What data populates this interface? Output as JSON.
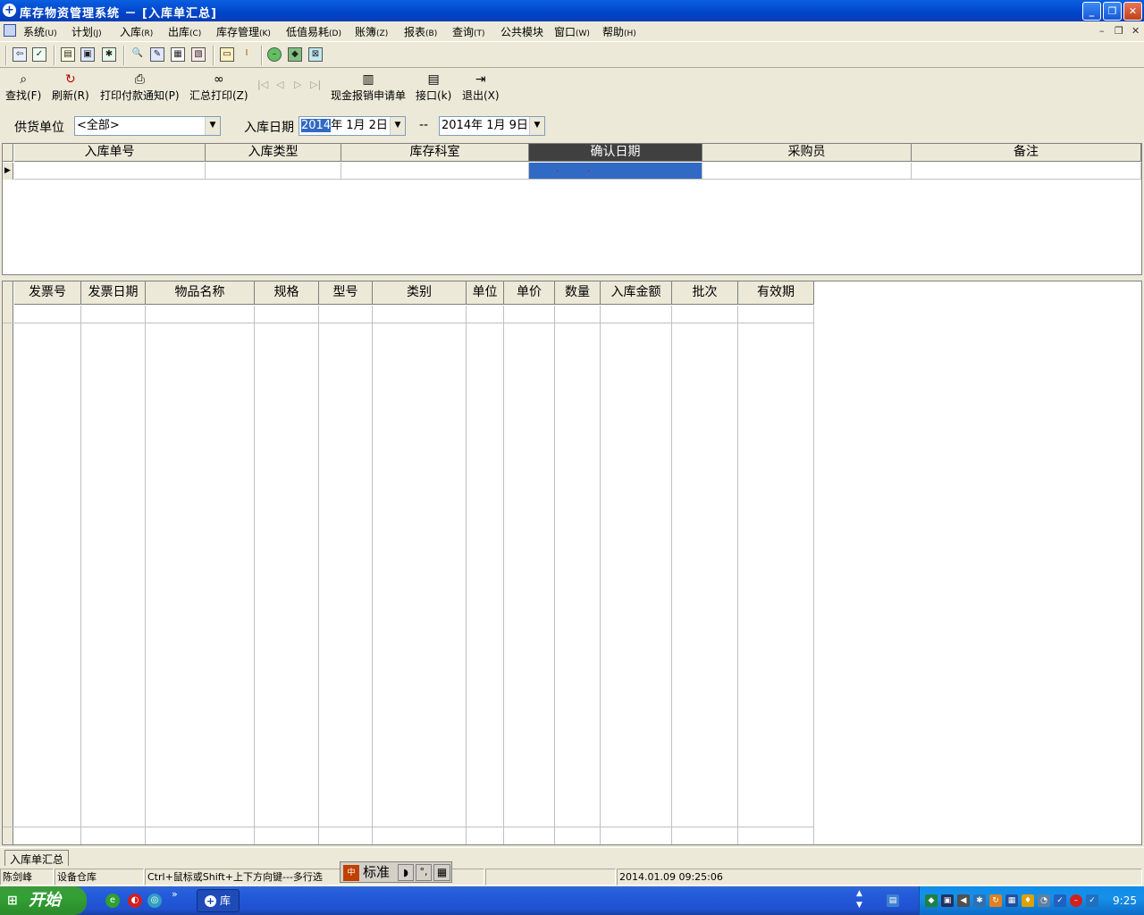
{
  "window": {
    "title": "库存物资管理系统 － [入库单汇总]"
  },
  "menu": [
    {
      "label": "系统",
      "key": "(U)"
    },
    {
      "label": "计划",
      "key": "(J)"
    },
    {
      "label": "入库",
      "key": "(R)"
    },
    {
      "label": "出库",
      "key": "(C)"
    },
    {
      "label": "库存管理",
      "key": "(K)"
    },
    {
      "label": "低值易耗",
      "key": "(D)"
    },
    {
      "label": "账簿",
      "key": "(Z)"
    },
    {
      "label": "报表",
      "key": "(B)"
    },
    {
      "label": "查询",
      "key": "(T)"
    },
    {
      "label": "公共模块",
      "key": ""
    },
    {
      "label": "窗口",
      "key": "(W)"
    },
    {
      "label": "帮助",
      "key": "(H)"
    }
  ],
  "toolbar2": {
    "find": "查找(F)",
    "refresh": "刷新(R)",
    "print_notice": "打印付款通知(P)",
    "summary_print": "汇总打印(Z)",
    "cash_request": "现金报销申请单",
    "interface": "接口(k)",
    "exit": "退出(X)"
  },
  "filter": {
    "supplier_label": "供货单位",
    "supplier_value": "<全部>",
    "date_label": "入库日期",
    "date_from_year": "2014",
    "date_from_rest": "年  1月  2日",
    "date_sep": "--",
    "date_to": "2014年  1月  9日"
  },
  "grid1": {
    "columns": [
      "入库单号",
      "入库类型",
      "库存科室",
      "确认日期",
      "采购员",
      "备注"
    ],
    "selected_column": "确认日期",
    "row_placeholder": ". ."
  },
  "grid2": {
    "columns": [
      "发票号",
      "发票日期",
      "物品名称",
      "规格",
      "型号",
      "类别",
      "单位",
      "单价",
      "数量",
      "入库金额",
      "批次",
      "有效期"
    ]
  },
  "tab": {
    "label": "入库单汇总"
  },
  "status": {
    "user": "陈剑峰",
    "warehouse": "设备仓库",
    "hint": "Ctrl+鼠标或Shift+上下方向键---多行选",
    "datetime": "2014.01.09 09:25:06"
  },
  "ime": {
    "label": "标准"
  },
  "taskbar": {
    "start": "开始",
    "task": "库",
    "clock": "9:25"
  }
}
